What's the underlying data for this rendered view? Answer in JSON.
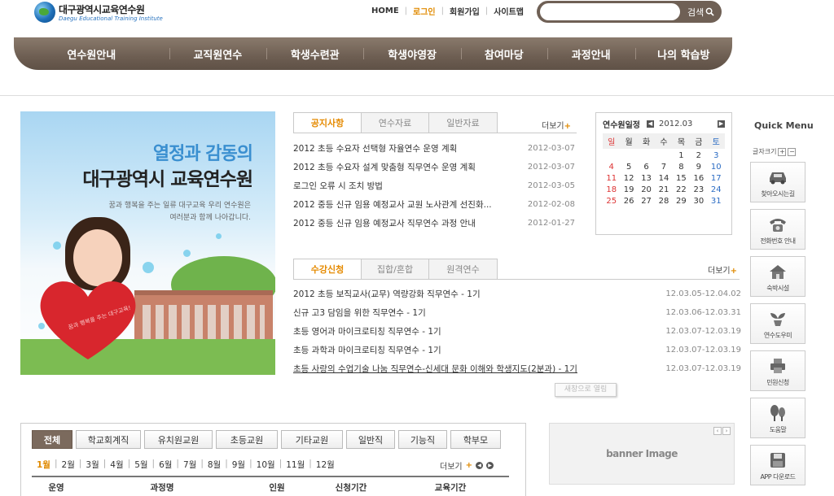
{
  "header": {
    "logo_kr": "대구광역시교육연수원",
    "logo_en": "Daegu Educational Training Institute",
    "util_links": [
      {
        "label": "HOME",
        "active": false
      },
      {
        "label": "로그인",
        "active": true
      },
      {
        "label": "회원가입",
        "active": false
      },
      {
        "label": "사이트맵",
        "active": false
      }
    ],
    "search": {
      "placeholder": "",
      "button_label": "검색"
    }
  },
  "gnb": [
    "연수원안내",
    "교직원연수",
    "학생수련관",
    "학생야영장",
    "참여마당",
    "과정안내",
    "나의 학습방"
  ],
  "hero": {
    "title1": "열정과 감동의",
    "title2": "대구광역시 교육연수원",
    "sub1": "꿈과 행복을 주는 일류 대구교육 우리 연수원은",
    "sub2": "여러분과 함께 나아갑니다.",
    "heart_text": "꿈과 행복을 주는 대구교육!"
  },
  "notice": {
    "tabs": [
      "공지사항",
      "연수자료",
      "일반자료"
    ],
    "more": "더보기",
    "items": [
      {
        "title": "2012 초등 수요자 선택형 자율연수 운영 계획",
        "date": "2012-03-07"
      },
      {
        "title": "2012 초등 수요자 설계 맞춤형 직무연수 운영 계획",
        "date": "2012-03-07"
      },
      {
        "title": "로그인 오류 시 조치 방법",
        "date": "2012-03-05"
      },
      {
        "title": "2012 중등 신규 임용 예정교사 교원 노사관계 선진화...",
        "date": "2012-02-08"
      },
      {
        "title": "2012 중등 신규 임용 예정교사 직무연수 과정 안내",
        "date": "2012-01-27"
      }
    ]
  },
  "apply": {
    "tabs": [
      "수강신청",
      "집합/혼합",
      "원격연수"
    ],
    "more": "더보기",
    "items": [
      {
        "title": "2012 초등 보직교사(교무) 역량강화 직무연수 - 1기",
        "date": "12.03.05-12.04.02"
      },
      {
        "title": "신규 고3 담임을 위한 직무연수 - 1기",
        "date": "12.03.06-12.03.31"
      },
      {
        "title": "초등 영어과 마이크로티칭 직무연수 - 1기",
        "date": "12.03.07-12.03.19"
      },
      {
        "title": "초등 과학과 마이크로티칭 직무연수 - 1기",
        "date": "12.03.07-12.03.19"
      },
      {
        "title": "초등 사랑의 수업기술 나눔 직무연수-신세대 문화 이해와 학생지도(2분과) - 1기",
        "date": "12.03.07-12.03.19"
      }
    ],
    "tooltip": "새창으로 열림"
  },
  "calendar": {
    "title": "연수원일정",
    "month": "2012.03",
    "weekdays": [
      "일",
      "월",
      "화",
      "수",
      "목",
      "금",
      "토"
    ],
    "rows": [
      [
        "",
        "",
        "",
        "",
        "1",
        "2",
        "3"
      ],
      [
        "4",
        "5",
        "6",
        "7",
        "8",
        "9",
        "10"
      ],
      [
        "11",
        "12",
        "13",
        "14",
        "15",
        "16",
        "17"
      ],
      [
        "18",
        "19",
        "20",
        "21",
        "22",
        "23",
        "24"
      ],
      [
        "25",
        "26",
        "27",
        "28",
        "29",
        "30",
        "31"
      ]
    ]
  },
  "quick_menu": {
    "title": "Quick Menu",
    "font_label": "글자크기",
    "items": [
      {
        "label": "찾아오시는길",
        "icon": "car-icon"
      },
      {
        "label": "전화번호 안내",
        "icon": "phone-icon"
      },
      {
        "label": "숙박시설",
        "icon": "house-icon"
      },
      {
        "label": "연수도우미",
        "icon": "plant-icon"
      },
      {
        "label": "민원신청",
        "icon": "printer-icon"
      },
      {
        "label": "도움말",
        "icon": "tree-icon"
      },
      {
        "label": "APP 다운로드",
        "icon": "save-icon"
      }
    ]
  },
  "course": {
    "tabs": [
      "전체",
      "학교회계직",
      "유치원교원",
      "초등교원",
      "기타교원",
      "일반직",
      "기능직",
      "학부모"
    ],
    "months": [
      "1월",
      "2월",
      "3월",
      "4월",
      "5월",
      "6월",
      "7월",
      "8월",
      "9월",
      "10월",
      "11월",
      "12월"
    ],
    "more": "더보기",
    "columns": [
      "운영",
      "과정명",
      "인원",
      "신청기간",
      "교육기간"
    ]
  },
  "banner": {
    "text": "banner Image"
  }
}
